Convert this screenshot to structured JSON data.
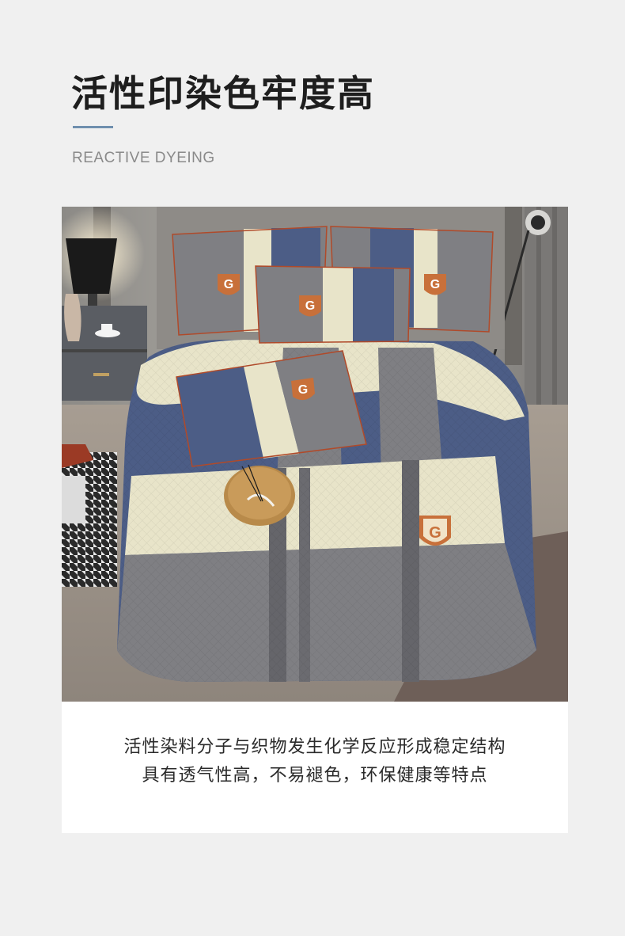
{
  "header": {
    "title": "活性印染色牢度高",
    "subtitle": "REACTIVE DYEING"
  },
  "photo": {
    "emblem_letter": "G"
  },
  "caption": {
    "line1": "活性染料分子与织物发生化学反应形成稳定结构",
    "line2": "具有透气性高，不易褪色，环保健康等特点"
  },
  "colors": {
    "accent_underline": "#6f8fae",
    "navy_fabric": "#4c5d86",
    "grey_fabric": "#7f7f83",
    "cream_fabric": "#e8e4c9",
    "emblem_orange": "#c8703a"
  }
}
